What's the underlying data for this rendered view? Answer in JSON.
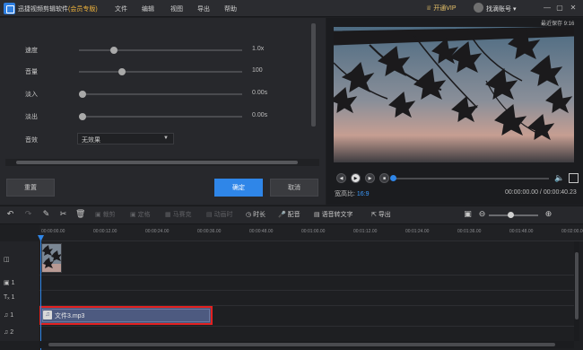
{
  "app": {
    "title": "迅捷视频剪辑软件",
    "edition": "(会员专版)"
  },
  "menu": [
    "文件",
    "编辑",
    "视图",
    "导出",
    "帮助"
  ],
  "vip_label": "开通VIP",
  "user_label": "找滴账号",
  "window_controls": [
    "—",
    "▢",
    "✕"
  ],
  "autosave": "最近保存 9:16",
  "audio_props": {
    "speed": {
      "label": "速度",
      "value": "1.0x",
      "level": 0.2
    },
    "volume": {
      "label": "音量",
      "value": "100",
      "level": 0.25
    },
    "fade_in": {
      "label": "淡入",
      "value": "0.00s",
      "level": 0
    },
    "fade_out": {
      "label": "淡出",
      "value": "0.00s",
      "level": 0
    },
    "sound_effect": {
      "label": "音效",
      "value": "无效果"
    }
  },
  "buttons": {
    "reset": "重置",
    "confirm": "确定",
    "cancel": "取消"
  },
  "player": {
    "aspect_label": "宽高比:",
    "aspect_value": "16:9",
    "time": "00:00:00.00 / 00:00:40.23",
    "progress": 0
  },
  "toolbar": {
    "crop": "裁剪",
    "freeze": "定格",
    "mosaic": "马赛克",
    "animation": "动画时",
    "duration": "时长",
    "dubbing": "配音",
    "tts": "语音转文字",
    "export": "导出"
  },
  "ruler": [
    "00:00:00.00",
    "00:00:12.00",
    "00:00:24.00",
    "00:00:36.00",
    "00:00:48.00",
    "00:01:00.00",
    "00:01:12.00",
    "00:01:24.00",
    "00:01:36.00",
    "00:01:48.00",
    "00:02:00.00"
  ],
  "tracks": [
    "1",
    "1",
    "1",
    "1",
    "2"
  ],
  "audio_clip": {
    "name": "文件3.mp3"
  }
}
